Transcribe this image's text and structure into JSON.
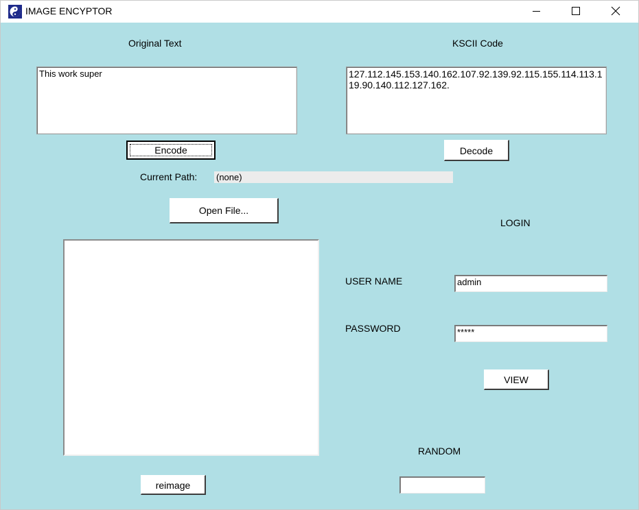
{
  "window": {
    "title": "IMAGE ENCYPTOR",
    "icon": "yin-yang-app-icon"
  },
  "encoder": {
    "original_label": "Original Text",
    "original_text": "This work super",
    "ksc_label": "KSCII Code",
    "ksc_text": "127.112.145.153.140.162.107.92.139.92.115.155.114.113.119.90.140.112.127.162.",
    "encode_label": "Encode",
    "decode_label": "Decode"
  },
  "file": {
    "path_label": "Current Path:",
    "path_value": "(none)",
    "open_label": "Open File...",
    "reimage_label": "reimage"
  },
  "login": {
    "heading": "LOGIN",
    "username_label": "USER NAME",
    "username_value": "admin",
    "password_label": "PASSWORD",
    "password_value": "*****",
    "view_label": "VIEW",
    "random_label": "RANDOM",
    "random_value": ""
  }
}
